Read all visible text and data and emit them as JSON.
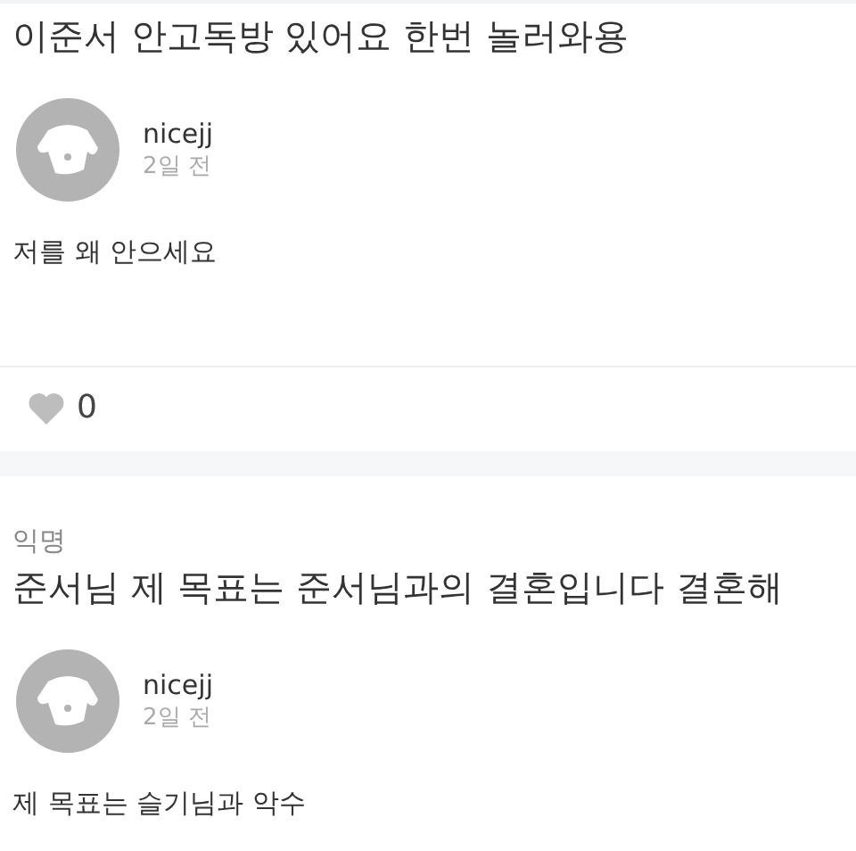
{
  "posts": [
    {
      "title": "이준서 안고독방 있어요 한번 놀러와용",
      "author": "nicejj",
      "time": "2일 전",
      "body": "저를 왜 안으세요",
      "likes": "0"
    },
    {
      "category": "익명",
      "title": "준서님 제 목표는 준서님과의 결혼입니다 결혼해",
      "author": "nicejj",
      "time": "2일 전",
      "body": "제 목표는 슬기님과 악수"
    }
  ]
}
